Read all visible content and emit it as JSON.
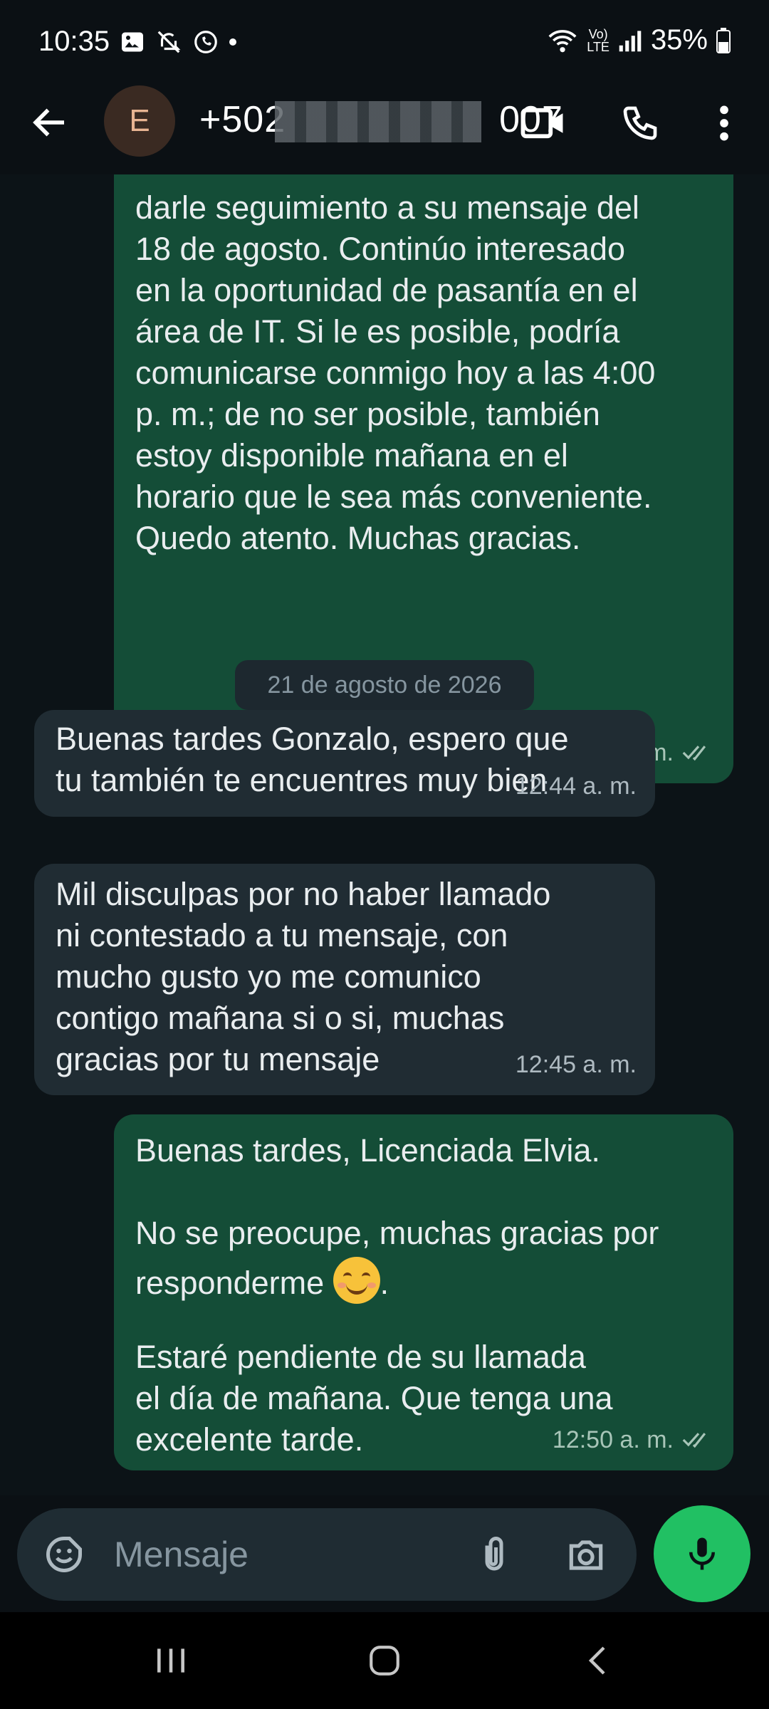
{
  "status_bar": {
    "time": "10:35",
    "battery": "35%",
    "network": "LTE"
  },
  "header": {
    "avatar_initial": "E",
    "contact_number_prefix": "+502",
    "contact_number_suffix": "007"
  },
  "messages": [
    {
      "direction": "outgoing",
      "text": "darle seguimiento a su mensaje del\n18 de agosto. Continúo interesado\nen la oportunidad de pasantía en el\nárea de IT. Si le es posible, podría\ncomunicarse conmigo hoy a las 4:00\np. m.; de no ser posible, también\nestoy disponible mañana en el\nhorario que le sea más conveniente.\nQuedo atento. Muchas gracias.",
      "time": "11:18 p. m."
    },
    {
      "direction": "incoming",
      "text": "Buenas tardes Gonzalo, espero que\ntu también te encuentres muy bien",
      "time": "12:44 a. m."
    },
    {
      "direction": "incoming",
      "text": "Mil disculpas por no haber llamado\nni contestado a tu mensaje, con\nmucho gusto yo me comunico\ncontigo mañana si o si, muchas\ngracias por tu mensaje",
      "time": "12:45 a. m."
    },
    {
      "direction": "outgoing",
      "line1": "Buenas tardes, Licenciada Elvia.",
      "line2a": "No se preocupe, muchas gracias por",
      "line2b": "responderme",
      "line2c": ".",
      "line3": "Estaré pendiente de su llamada\nel día de mañana. Que tenga una\nexcelente tarde.",
      "time": "12:50 a. m."
    }
  ],
  "date_divider": "21 de agosto de 2026",
  "input": {
    "placeholder": "Mensaje"
  },
  "colors": {
    "outgoing_bubble": "#144d37",
    "incoming_bubble": "#202c33",
    "accent": "#21c063",
    "read_ticks": "#a8c5b8"
  }
}
